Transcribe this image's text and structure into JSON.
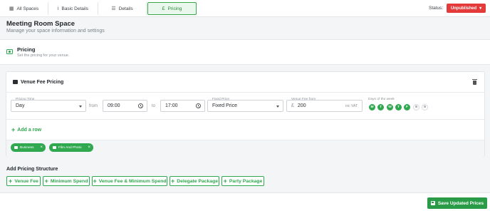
{
  "tabs": [
    {
      "icon": "grid-icon",
      "glyph": "▦",
      "label": "All Spaces"
    },
    {
      "icon": "info-icon",
      "glyph": "i",
      "label": "Basic Details"
    },
    {
      "icon": "list-icon",
      "glyph": "☰",
      "label": "Details"
    },
    {
      "icon": "pound-icon",
      "glyph": "£",
      "label": "Pricing"
    }
  ],
  "status": {
    "label": "Status:",
    "value": "Unpublished",
    "color": "#e53a3a"
  },
  "header": {
    "title": "Meeting Room Space",
    "subtitle": "Manage your space information and settings"
  },
  "pricing": {
    "title": "Pricing",
    "subtitle": "Set the pricing for your venue."
  },
  "venue_fee": {
    "title": "Venue Fee Pricing",
    "pricing_time": {
      "label": "Pricing Time",
      "value": "Day"
    },
    "from_word": "from",
    "from_time": "09:00",
    "to_word": "to",
    "to_time": "17:00",
    "fixed_price": {
      "label": "Fixed Price",
      "value": "Fixed Price"
    },
    "venue_fee_from": {
      "label": "Venue Fee from",
      "currency": "£",
      "value": "200",
      "suffix": "inc VAT"
    },
    "days_label": "Days of the week",
    "days": [
      {
        "letter": "M",
        "active": true
      },
      {
        "letter": "T",
        "active": true
      },
      {
        "letter": "W",
        "active": true
      },
      {
        "letter": "T",
        "active": true
      },
      {
        "letter": "F",
        "active": true
      },
      {
        "letter": "S",
        "active": false
      },
      {
        "letter": "S",
        "active": false
      }
    ],
    "add_row": "Add a row",
    "chips": [
      "Business",
      "Film And Photo"
    ]
  },
  "add_structure": {
    "title": "Add Pricing Structure",
    "buttons": [
      "Venue Fee",
      "Minimum Spend",
      "Venue Fee & Minimum Spend",
      "Delegate Package",
      "Party Package"
    ]
  },
  "footer": {
    "save_label": "Save Updated Prices"
  },
  "colors": {
    "accent": "#2fa84f",
    "danger": "#e53a3a"
  }
}
